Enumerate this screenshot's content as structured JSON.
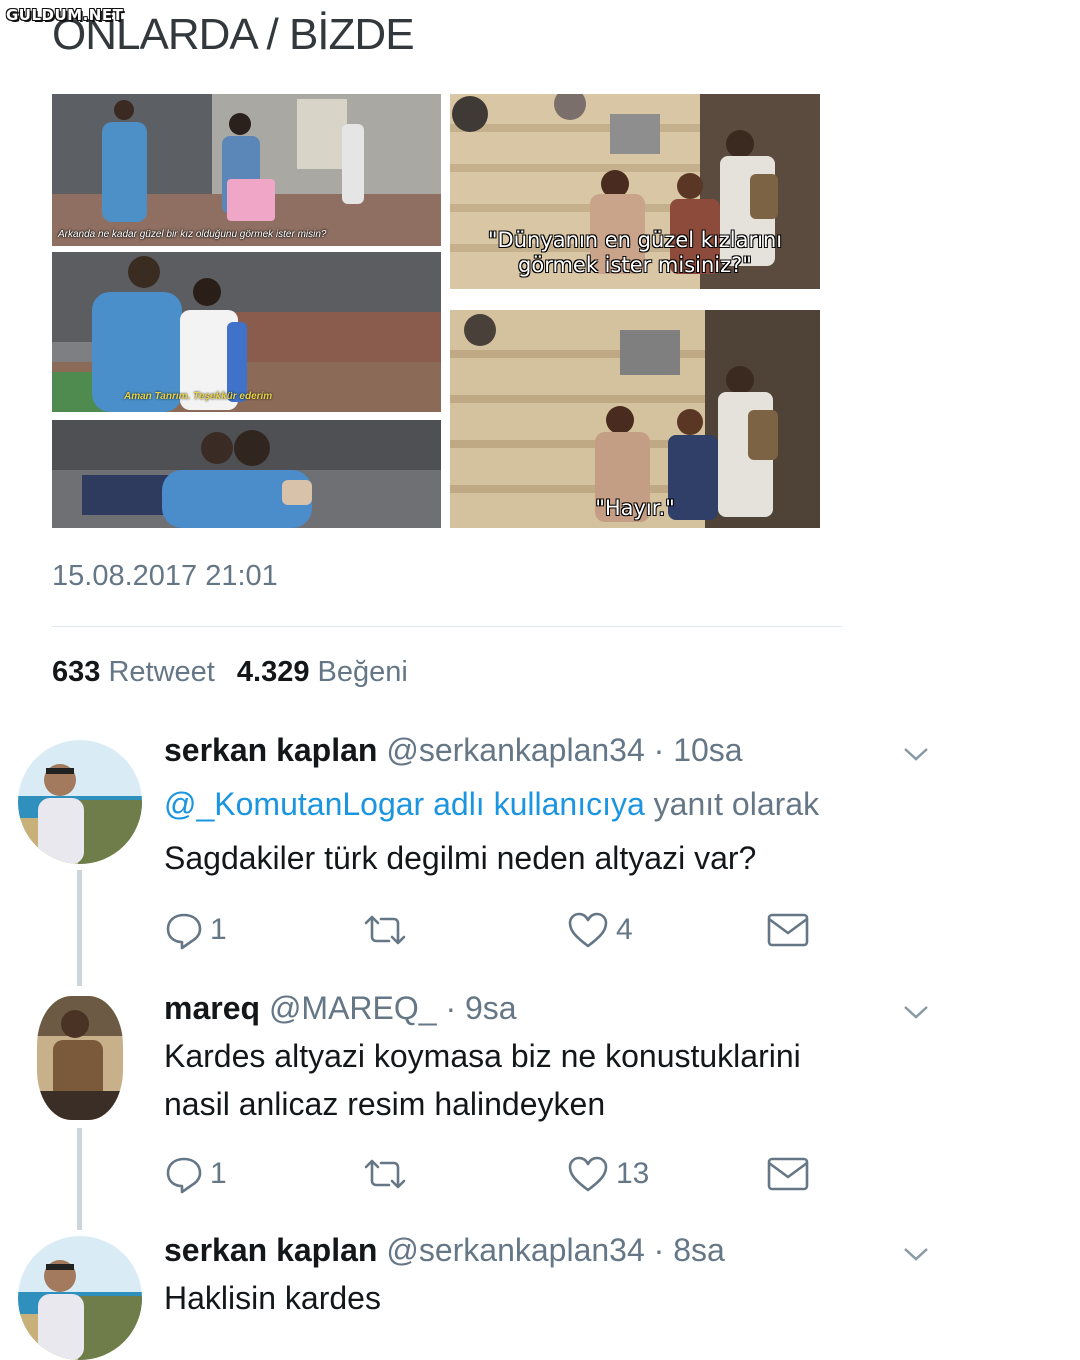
{
  "watermark": "GULDUM.NET",
  "title": "ONLARDA / BİZDE",
  "photos": {
    "left_top_caption": "Arkanda ne kadar güzel bir kız olduğunu görmek ister misin?",
    "left_mid_caption": "Aman Tanrım. Teşekkür ederim",
    "right_top_caption_line1": "\"Dünyanın en güzel kızlarını",
    "right_top_caption_line2": "görmek ister misiniz?\"",
    "right_bottom_caption": "\"Hayır.\""
  },
  "tweet": {
    "timestamp": "15.08.2017 21:01",
    "retweet_count": "633",
    "retweet_label": "Retweet",
    "like_count": "4.329",
    "like_label": "Beğeni"
  },
  "replies": [
    {
      "name": "serkan kaplan",
      "handle": "@serkankaplan34",
      "time": "· 10sa",
      "reply_to_mention": "@_KomutanLogar adlı kullanıcıya",
      "reply_to_suffix": "yanıt olarak",
      "text_lines": [
        "Sagdakiler türk degilmi neden altyazi var?"
      ],
      "reply_count": "1",
      "like_count": "4"
    },
    {
      "name": "mareq",
      "handle": "@MAREQ_",
      "time": "· 9sa",
      "text_lines": [
        "Kardes altyazi koymasa biz ne konustuklarini",
        "nasil anlicaz resim halindeyken"
      ],
      "reply_count": "1",
      "like_count": "13"
    },
    {
      "name": "serkan kaplan",
      "handle": "@serkankaplan34",
      "time": "· 8sa",
      "text_lines": [
        "Haklisin kardes"
      ]
    }
  ],
  "icons": {
    "reply": "reply-icon",
    "retweet": "retweet-icon",
    "like": "heart-icon",
    "dm": "mail-icon",
    "more": "chevron-down-icon"
  },
  "colors": {
    "link": "#1b95e0",
    "muted": "#657786",
    "text": "#14171a",
    "thread": "#ccd6dd"
  }
}
